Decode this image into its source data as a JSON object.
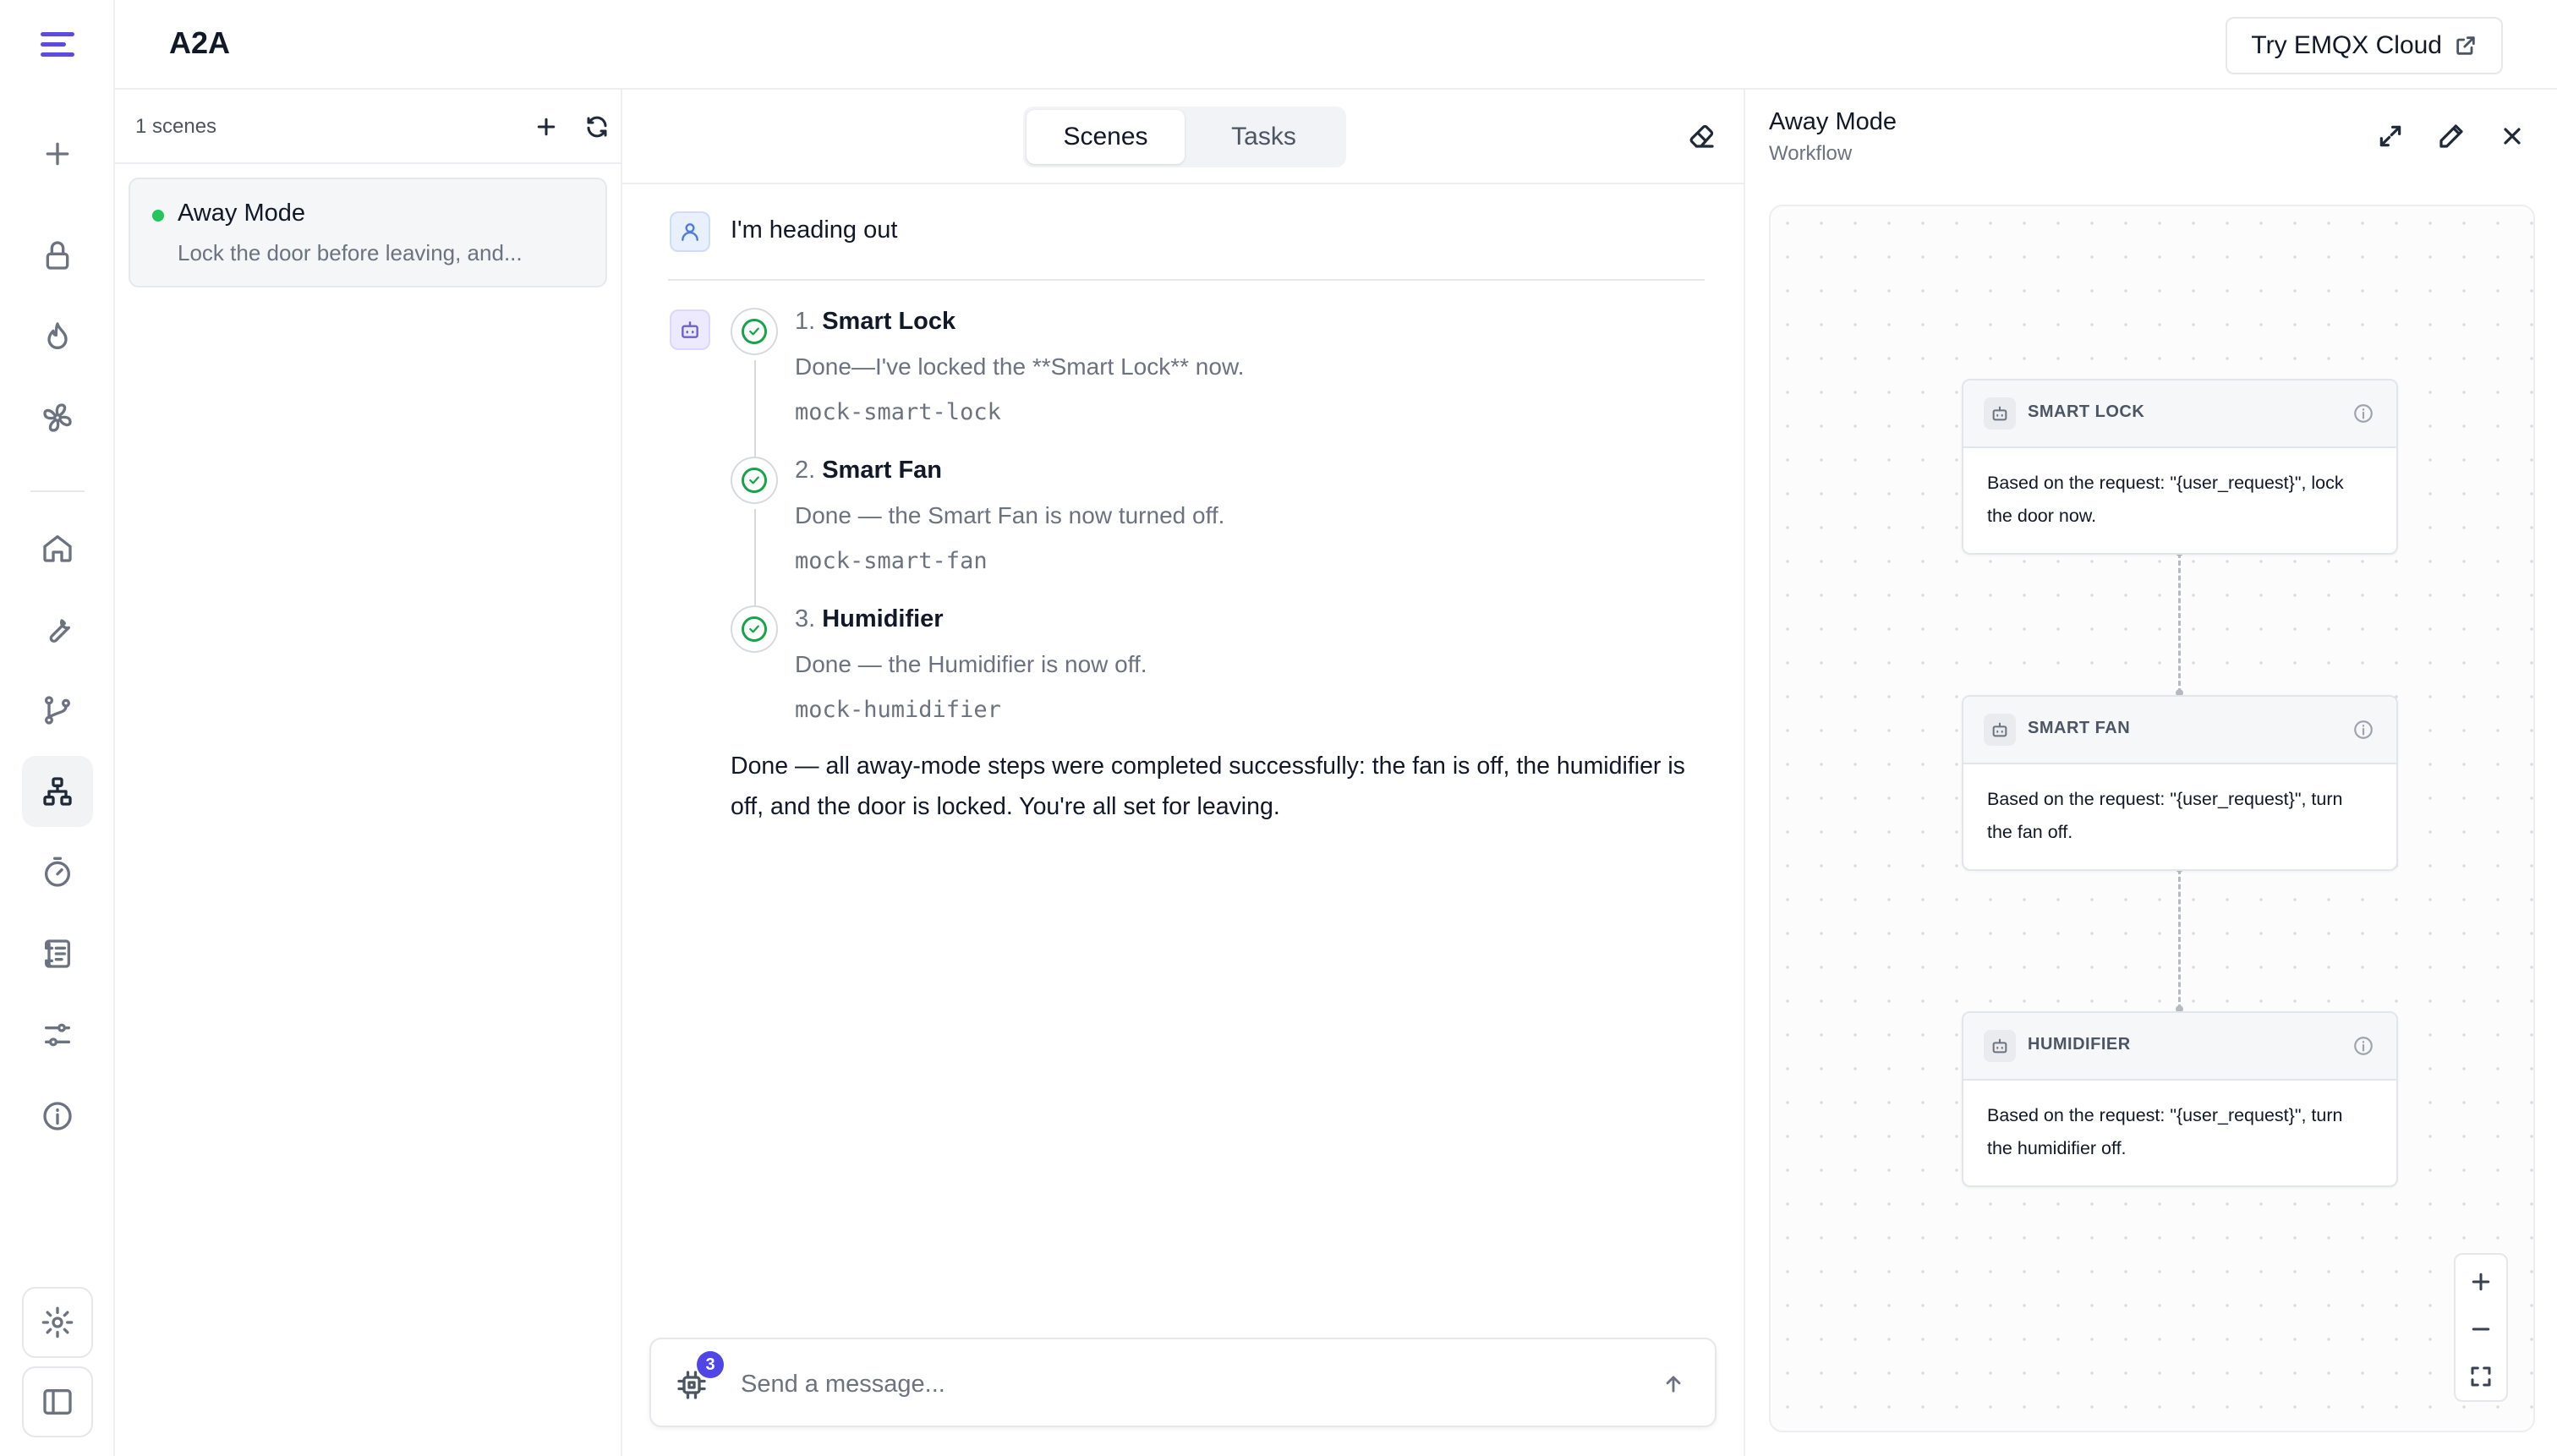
{
  "app": {
    "title": "A2A",
    "cloud_button": "Try EMQX Cloud"
  },
  "rail": {
    "icons": [
      "menu-logo-icon",
      "plus-icon",
      "lock-icon",
      "flame-icon",
      "fan-icon",
      "home-icon",
      "wrench-icon",
      "git-branch-icon",
      "network-icon",
      "timer-icon",
      "scroll-icon",
      "sliders-icon",
      "info-icon",
      "settings-icon",
      "sidebar-toggle-icon"
    ],
    "active": "network-icon"
  },
  "scenes": {
    "count_label": "1 scenes",
    "items": [
      {
        "name": "Away Mode",
        "description": "Lock the door before leaving, and...",
        "status_color": "#22c55e"
      }
    ]
  },
  "chat": {
    "tabs": [
      {
        "label": "Scenes",
        "active": true
      },
      {
        "label": "Tasks",
        "active": false
      }
    ],
    "user_message": "I'm heading out",
    "steps": [
      {
        "number": "1.",
        "name": "Smart Lock",
        "text": "Done—I've locked the **Smart Lock** now.",
        "agent": "mock-smart-lock",
        "status": "done"
      },
      {
        "number": "2.",
        "name": "Smart Fan",
        "text": "Done — the Smart Fan is now turned off.",
        "agent": "mock-smart-fan",
        "status": "done"
      },
      {
        "number": "3.",
        "name": "Humidifier",
        "text": "Done — the Humidifier is now off.",
        "agent": "mock-humidifier",
        "status": "done"
      }
    ],
    "summary": "Done — all away-mode steps were completed successfully: the fan is off, the humidifier is off, and the door is locked. You're all set for leaving.",
    "composer": {
      "placeholder": "Send a message...",
      "agent_count": "3"
    }
  },
  "workflow": {
    "title": "Away Mode",
    "subtitle": "Workflow",
    "nodes": [
      {
        "label": "SMART LOCK",
        "body": "Based on the request: \"{user_request}\", lock the door now."
      },
      {
        "label": "SMART FAN",
        "body": "Based on the request: \"{user_request}\", turn the fan off."
      },
      {
        "label": "HUMIDIFIER",
        "body": "Based on the request: \"{user_request}\", turn the humidifier off."
      }
    ]
  },
  "colors": {
    "accent": "#5b4bdf",
    "success": "#16a34a",
    "badge": "#4f46e5",
    "status_dot": "#22c55e"
  }
}
